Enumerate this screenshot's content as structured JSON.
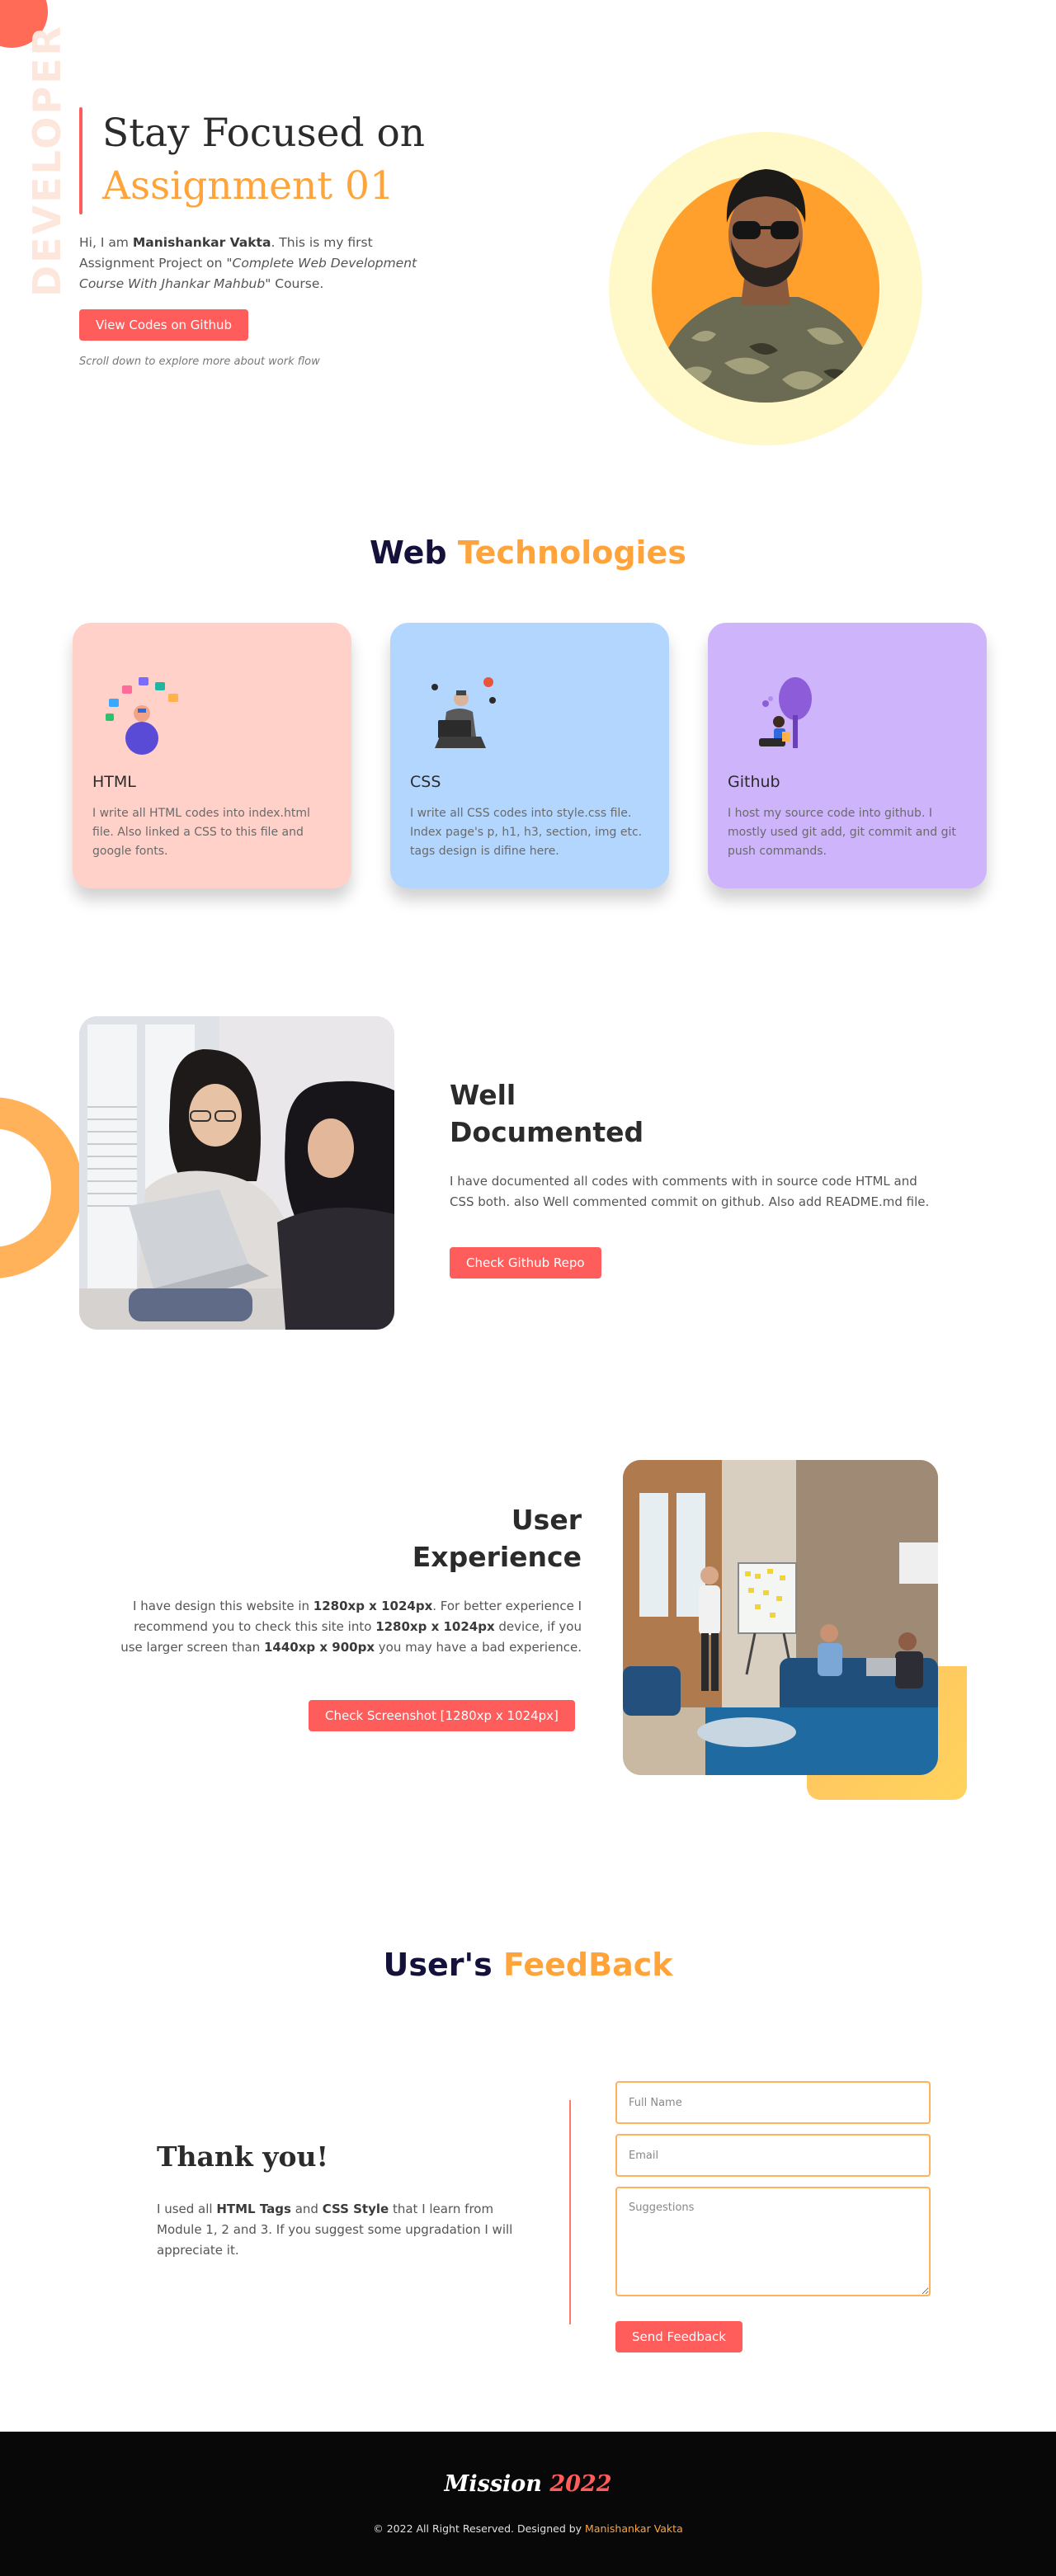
{
  "decor": {
    "side_word": "DEVELOPER"
  },
  "hero": {
    "title_line1": "Stay Focused on",
    "title_line2": "Assignment 01",
    "desc_prefix": "Hi, I am ",
    "desc_name": "Manishankar Vakta",
    "desc_mid": ". This is my first Assignment Project on ",
    "desc_course": "\"Complete Web Development Course With Jhankar Mahbub\"",
    "desc_suffix": " Course.",
    "button_label": "View Codes on Github",
    "scroll_hint": "Scroll down to explore more about work flow"
  },
  "technologies": {
    "heading_main": "Web ",
    "heading_accent": "Technologies",
    "cards": [
      {
        "title": "HTML",
        "text": "I write all HTML codes into index.html file. Also linked a CSS to this file and google fonts."
      },
      {
        "title": "CSS",
        "text": "I write all CSS codes into style.css file. Index page's p, h1, h3, section, img etc. tags design is difine here."
      },
      {
        "title": "Github",
        "text": "I host my source code into github. I mostly used git add, git commit and git push commands."
      }
    ]
  },
  "documented": {
    "title": "Well Documented",
    "text": "I have documented all codes with comments with in source code HTML and CSS both. also Well commented commit on github. Also add README.md file.",
    "button_label": "Check Github Repo"
  },
  "ux": {
    "title": "User Experience",
    "desc_1": "I have design this website in ",
    "res_1": "1280xp x 1024px",
    "desc_2": ". For better experience I recommend you to check this site into ",
    "res_2": "1280xp x 1024px",
    "desc_3": " device, if you use larger screen than ",
    "res_3": "1440xp x 900px",
    "desc_4": " you may have a bad experience.",
    "button_label": "Check Screenshot [1280xp x 1024px]"
  },
  "feedback": {
    "heading_main": "User's ",
    "heading_accent": "FeedBack",
    "thank_title": "Thank you!",
    "thank_1": "I used all ",
    "thank_tags": "HTML Tags",
    "thank_and": " and ",
    "thank_css": "CSS Style",
    "thank_2": " that I learn from Module 1, 2 and 3. If you suggest some upgradation I will appreciate it.",
    "name_placeholder": "Full Name",
    "email_placeholder": "Email",
    "suggestions_placeholder": "Suggestions",
    "button_label": "Send Feedback"
  },
  "footer": {
    "logo_main": "Mission ",
    "logo_accent": "2022",
    "copy_text": "© 2022 All Right Reserved. Designed by ",
    "copy_name": "Manishankar Vakta"
  },
  "colors": {
    "accent_orange": "#ffa43a",
    "button_red": "#ff5c5c",
    "heading_navy": "#14123b",
    "card_html": "#ffd1c9",
    "card_css": "#b3d6ff",
    "card_github": "#cdb4fb",
    "footer_bg": "#080808"
  }
}
